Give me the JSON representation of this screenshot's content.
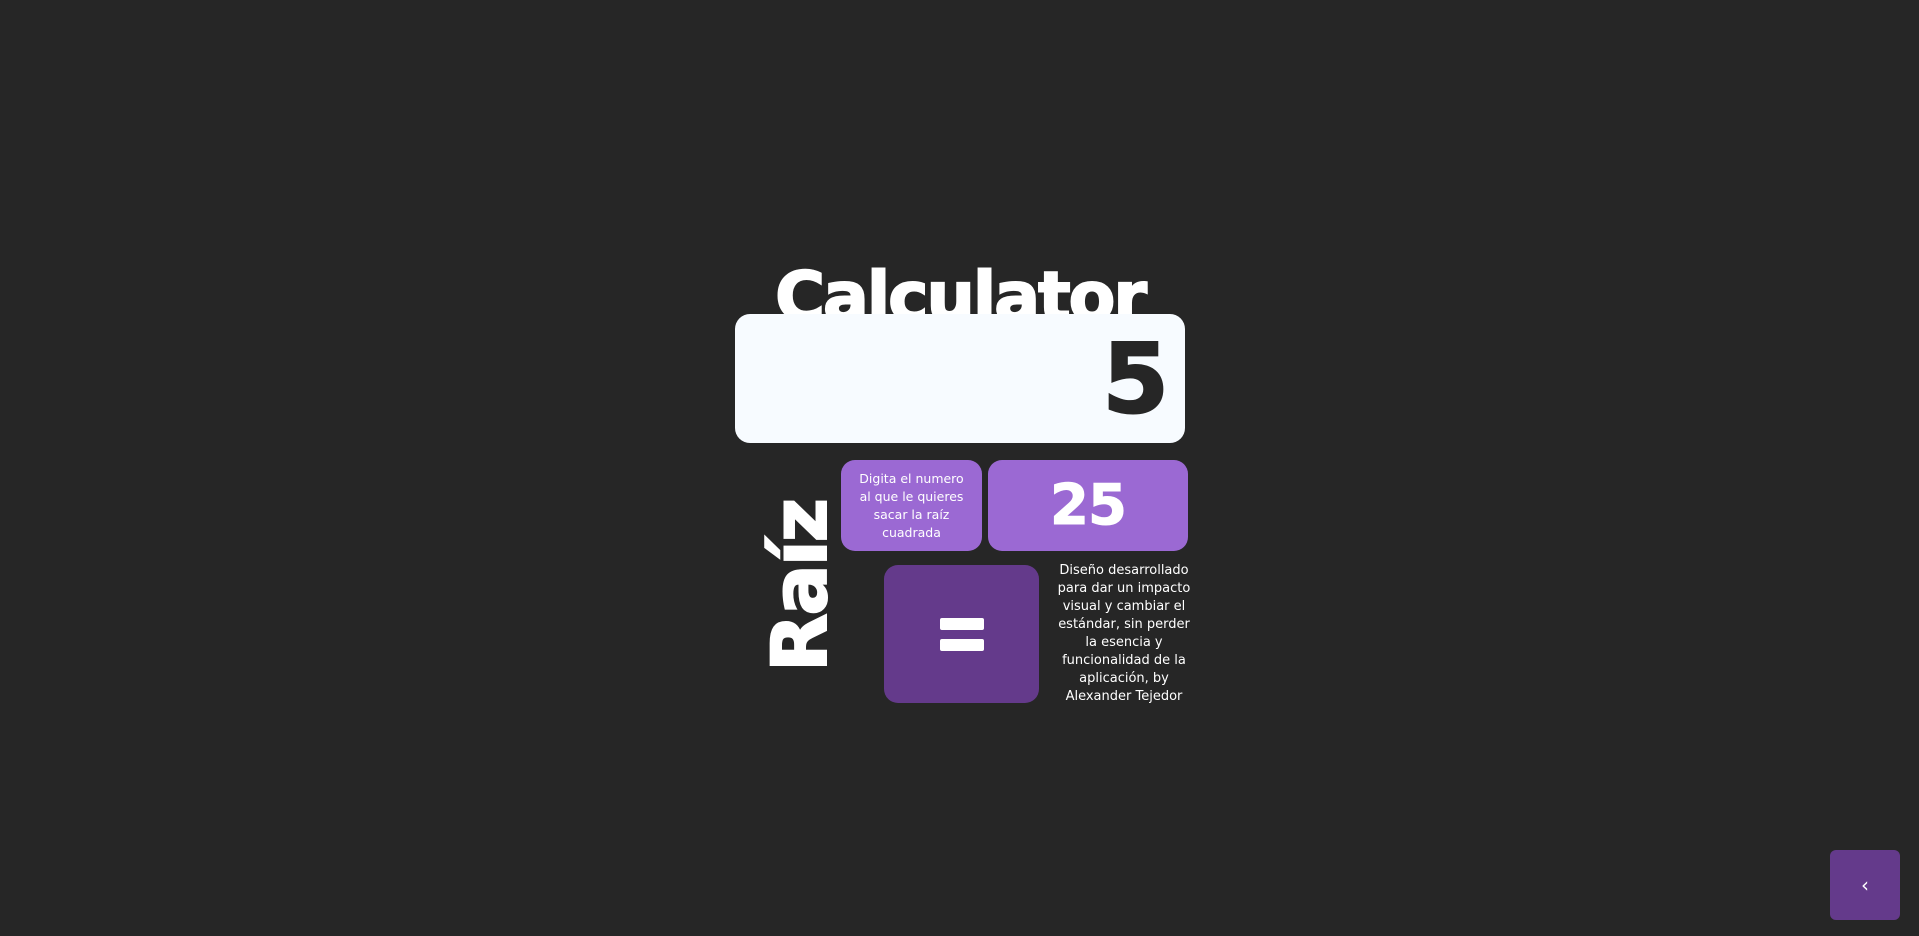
{
  "app": {
    "title": "Calculator",
    "mode_label": "Raíz"
  },
  "display": {
    "value": "5"
  },
  "input": {
    "hint": "Digita el numero al que le quieres sacar la raíz cuadrada",
    "value": "25"
  },
  "actions": {
    "equals_label": "=",
    "back_icon": "‹"
  },
  "about": {
    "text": "Diseño desarrollado para dar un impacto visual y cambiar el estándar, sin perder la esencia y funcionalidad de la aplicación, by Alexander Tejedor"
  },
  "colors": {
    "background": "#262626",
    "display_bg": "#f7fbff",
    "accent_light": "#9b69d3",
    "accent_dark": "#643a8b",
    "text_light": "#ffffff",
    "text_dark": "#262626"
  }
}
